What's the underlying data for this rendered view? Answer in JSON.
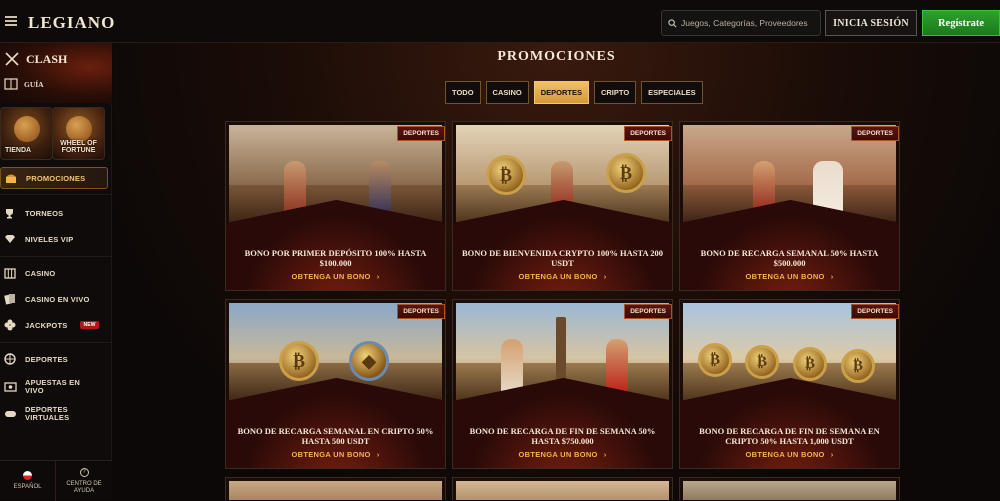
{
  "header": {
    "logo": "LEGIANO",
    "search_placeholder": "Juegos, Categorías, Proveedores",
    "login_label": "INICIA SESIÓN",
    "register_label": "Regístrate"
  },
  "sidebar": {
    "clash_title": "CLASH",
    "guide_label": "GUÍA",
    "tiles": [
      {
        "label": "TIENDA"
      },
      {
        "label": "WHEEL OF FORTUNE"
      }
    ],
    "items": [
      {
        "label": "PROMOCIONES",
        "icon": "treasure-chest-icon"
      },
      {
        "label": "TORNEOS",
        "icon": "trophy-icon"
      },
      {
        "label": "NIVELES VIP",
        "icon": "diamond-icon"
      },
      {
        "label": "CASINO",
        "icon": "slot-machine-icon"
      },
      {
        "label": "CASINO EN VIVO",
        "icon": "cards-icon"
      },
      {
        "label": "JACKPOTS",
        "icon": "clover-icon",
        "badge": "NEW"
      },
      {
        "label": "DEPORTES",
        "icon": "ball-icon"
      },
      {
        "label": "APUESTAS EN VIVO",
        "icon": "live-bet-icon"
      },
      {
        "label": "DEPORTES VIRTUALES",
        "icon": "gamepad-icon"
      }
    ],
    "footer": {
      "language": "ESPAÑOL",
      "help": "CENTRO DE AYUDA"
    }
  },
  "main": {
    "title": "PROMOCIONES",
    "filters": [
      "TODO",
      "CASINO",
      "DEPORTES",
      "CRIPTO",
      "ESPECIALES"
    ],
    "active_filter": "DEPORTES",
    "cards": [
      {
        "badge": "DEPORTES",
        "title": "BONO POR PRIMER DEPÓSITO 100% HASTA $100.000",
        "link": "OBTENGA UN BONO"
      },
      {
        "badge": "DEPORTES",
        "title": "BONO DE BIENVENIDA CRYPTO 100% HASTA 200 USDT",
        "link": "OBTENGA UN BONO"
      },
      {
        "badge": "DEPORTES",
        "title": "BONO DE RECARGA SEMANAL 50% HASTA $500.000",
        "link": "OBTENGA UN BONO"
      },
      {
        "badge": "DEPORTES",
        "title": "BONO DE RECARGA SEMANAL EN CRIPTO 50% HASTA 500 USDT",
        "link": "OBTENGA UN BONO"
      },
      {
        "badge": "DEPORTES",
        "title": "BONO DE RECARGA DE FIN DE SEMANA 50% HASTA $750.000",
        "link": "OBTENGA UN BONO"
      },
      {
        "badge": "DEPORTES",
        "title": "BONO DE RECARGA DE FIN DE SEMANA EN CRIPTO 50% HASTA 1,000 USDT",
        "link": "OBTENGA UN BONO"
      }
    ]
  },
  "colors": {
    "accent_gold": "#f2b347",
    "register_green": "#2fa02c",
    "badge_red": "#5a1410"
  }
}
